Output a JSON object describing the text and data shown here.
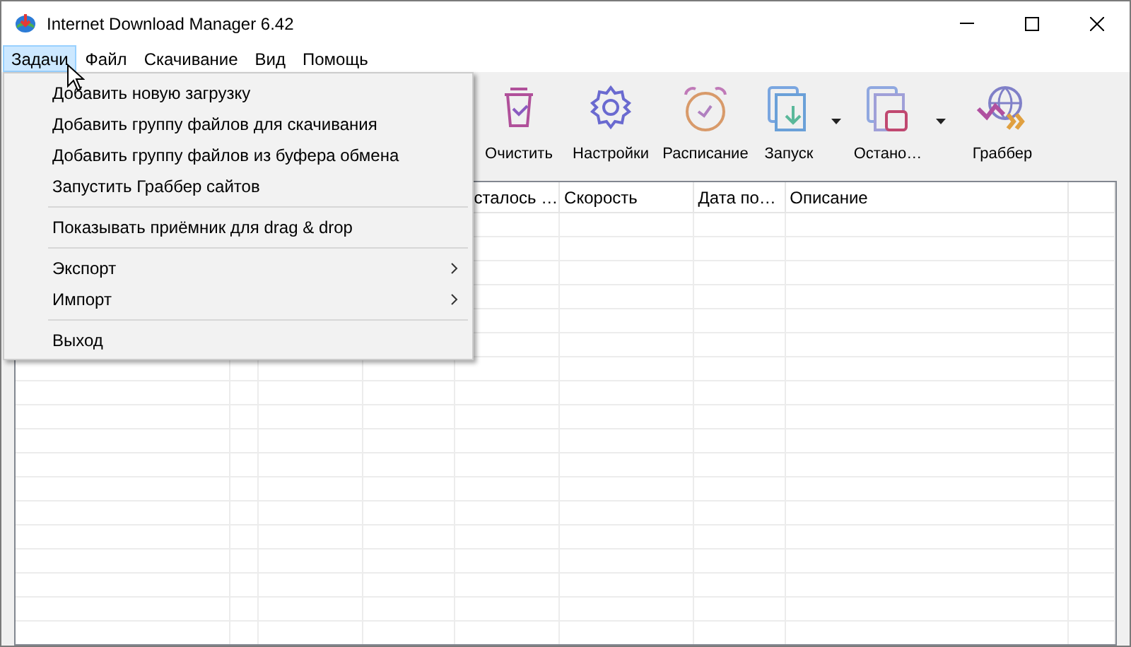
{
  "window": {
    "title": "Internet Download Manager 6.42"
  },
  "menu_bar": [
    {
      "label": "Задачи",
      "selected": true
    },
    {
      "label": "Файл",
      "selected": false
    },
    {
      "label": "Скачивание",
      "selected": false
    },
    {
      "label": "Вид",
      "selected": false
    },
    {
      "label": "Помощь",
      "selected": false
    }
  ],
  "dropdown_menu": [
    {
      "kind": "item",
      "label": "Добавить новую загрузку"
    },
    {
      "kind": "item",
      "label": "Добавить группу файлов для скачивания"
    },
    {
      "kind": "item",
      "label": "Добавить группу файлов из буфера обмена"
    },
    {
      "kind": "item",
      "label": "Запустить Граббер сайтов"
    },
    {
      "kind": "separator"
    },
    {
      "kind": "item",
      "label": "Показывать приёмник для drag & drop"
    },
    {
      "kind": "separator"
    },
    {
      "kind": "submenu",
      "label": "Экспорт"
    },
    {
      "kind": "submenu",
      "label": "Импорт"
    },
    {
      "kind": "separator"
    },
    {
      "kind": "item",
      "label": "Выход"
    }
  ],
  "toolbar": [
    {
      "label": "Очистить",
      "has_dropdown": false
    },
    {
      "label": "Настройки",
      "has_dropdown": false
    },
    {
      "label": "Расписание",
      "has_dropdown": false
    },
    {
      "label": "Запуск",
      "has_dropdown": true
    },
    {
      "label": "Остано…",
      "has_dropdown": true
    },
    {
      "label": "Граббер",
      "has_dropdown": false
    }
  ],
  "table": {
    "columns": [
      "сталось …",
      "Скорость",
      "Дата по…",
      "Описание"
    ]
  }
}
